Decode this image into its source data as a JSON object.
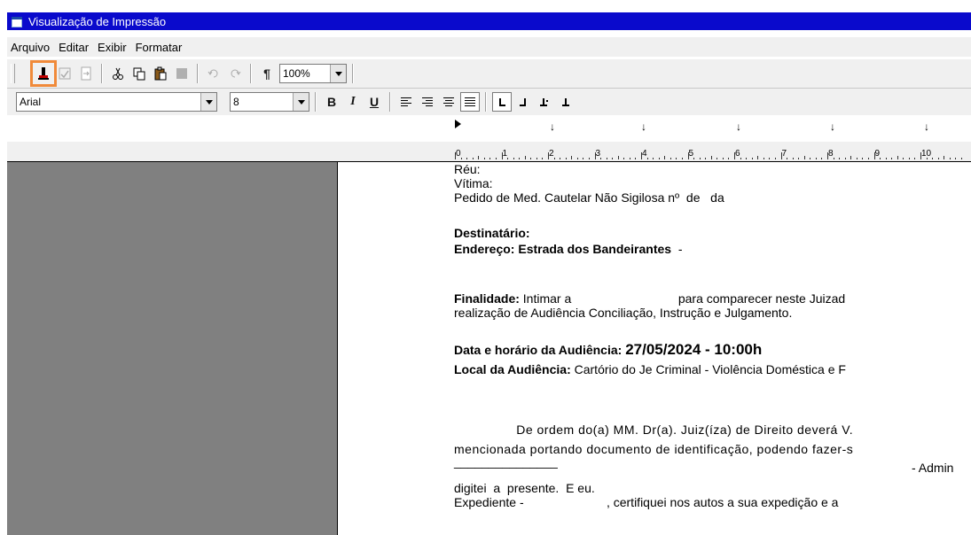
{
  "window": {
    "title": "Visualização de Impressão"
  },
  "menu": [
    "Arquivo",
    "Editar",
    "Exibir",
    "Formatar"
  ],
  "toolbar": {
    "zoom_value": "100%",
    "buttons": [
      "print-button",
      "preview-page-button",
      "send-button",
      "cut-button",
      "copy-button",
      "paste-button",
      "format-painter-button",
      "undo-button",
      "redo-button",
      "show-marks-button"
    ]
  },
  "format": {
    "font_name": "Arial",
    "font_size": "8",
    "bold_label": "B",
    "italic_label": "I",
    "underline_label": "U"
  },
  "ruler": {
    "numbers": [
      "0",
      "1",
      "2",
      "3",
      "4",
      "5",
      "6",
      "7",
      "8",
      "9",
      "10"
    ]
  },
  "document": {
    "reu_label": "Réu:",
    "vitima_label": "Vítima:",
    "pedido": "Pedido de Med. Cautelar Não Sigilosa nº  de   da",
    "destinatario_label": "Destinatário:",
    "endereco_label": "Endereço: Estrada dos Bandeirantes",
    "endereco_suffix": "  -",
    "finalidade_label": "Finalidade:",
    "finalidade_text": " Intimar a                               para comparecer neste Juizad",
    "finalidade_text2": "realização de Audiência Conciliação, Instrução e Julgamento.",
    "data_label": "Data e horário da Audiência: ",
    "data_value": "27/05/2024 - 10:00h",
    "local_label": "Local da Audiência:",
    "local_text": " Cartório do Je Criminal - Violência Doméstica e F",
    "ordem_text": "                De ordem do(a) MM. Dr(a). Juiz(íza) de Direito deverá V.",
    "mencionada_text": "mencionada portando documento de identificação, podendo fazer-s",
    "underline_text": "_______________",
    "admin_text": "- Admin",
    "digitei_text": "digitei  a  presente.  E eu.",
    "expediente_text": "Expediente -                        , certifiquei nos autos a sua expedição e a"
  }
}
